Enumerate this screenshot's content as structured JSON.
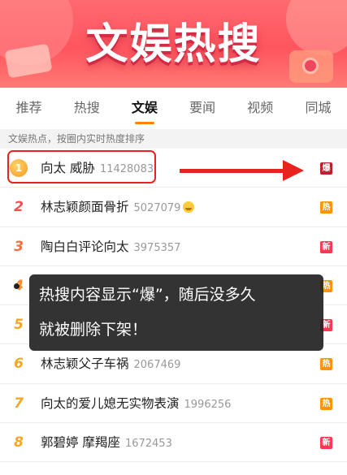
{
  "banner": {
    "title": "文娱热搜"
  },
  "tabs": [
    {
      "label": "推荐",
      "active": false
    },
    {
      "label": "热搜",
      "active": false
    },
    {
      "label": "文娱",
      "active": true
    },
    {
      "label": "要闻",
      "active": false
    },
    {
      "label": "视频",
      "active": false
    },
    {
      "label": "同城",
      "active": false
    }
  ],
  "section_header": "文娱热点，按圈内实时热度排序",
  "list": [
    {
      "rank": "1",
      "title": "向太 威胁",
      "count": "11428083",
      "badge": "爆",
      "badge_type": "bao"
    },
    {
      "rank": "2",
      "title": "林志颖颜面骨折",
      "count": "5027079",
      "badge": "热",
      "badge_type": "re",
      "emoji": "crying-face-icon"
    },
    {
      "rank": "3",
      "title": "陶白白评论向太",
      "count": "3975357",
      "badge": "新",
      "badge_type": "xin"
    },
    {
      "rank": "4",
      "title": "",
      "count": "",
      "badge": "热",
      "badge_type": "re"
    },
    {
      "rank": "5",
      "title": "",
      "count": "",
      "badge": "新",
      "badge_type": "xin"
    },
    {
      "rank": "6",
      "title": "林志颖父子车祸",
      "count": "2067469",
      "badge": "热",
      "badge_type": "re"
    },
    {
      "rank": "7",
      "title": "向太的爱儿媳无实物表演",
      "count": "1996256",
      "badge": "热",
      "badge_type": "re"
    },
    {
      "rank": "8",
      "title": "郭碧婷 摩羯座",
      "count": "1672453",
      "badge": "新",
      "badge_type": "xin"
    }
  ],
  "overlay": {
    "line1": "热搜内容显示“爆”，随后没多久",
    "line2": "就被删除下架！"
  },
  "colors": {
    "accent": "#ff8200",
    "annotation_red": "#e8231f",
    "badge_bao": "#bf1e2d",
    "badge_re": "#ff9406",
    "badge_xin": "#ff3852"
  }
}
